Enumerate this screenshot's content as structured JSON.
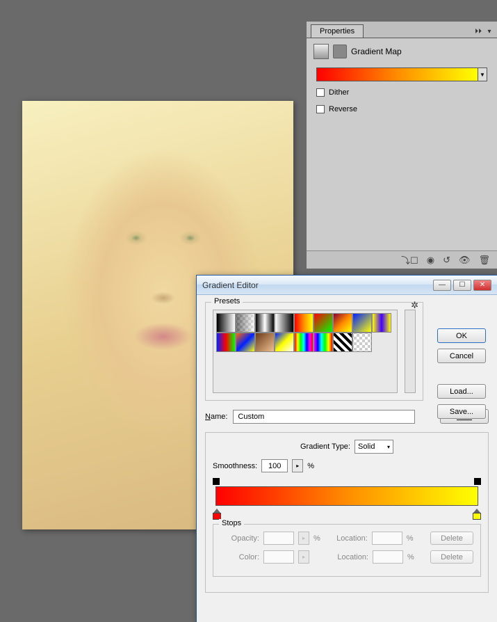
{
  "panel": {
    "tab": "Properties",
    "adjustment_name": "Gradient Map",
    "dither_label": "Dither",
    "reverse_label": "Reverse",
    "dropdown_glyph": "▼"
  },
  "dialog": {
    "title": "Gradient Editor",
    "ok": "OK",
    "cancel": "Cancel",
    "load": "Load...",
    "save": "Save...",
    "new": "New",
    "presets_label": "Presets",
    "name_label": "Name:",
    "name_value": "Custom",
    "type_label": "Gradient Type:",
    "type_value": "Solid",
    "smooth_label": "Smoothness:",
    "smooth_value": "100",
    "percent": "%",
    "stops_label": "Stops",
    "opacity_label": "Opacity:",
    "color_label": "Color:",
    "location_label": "Location:",
    "delete": "Delete",
    "gear": "✲",
    "arrow": "▸",
    "dropdown": "▾",
    "win_min": "—",
    "win_max": "☐",
    "win_close": "✕"
  },
  "chart_data": {
    "type": "gradient",
    "stops": [
      {
        "position": 0,
        "color": "#ff0000"
      },
      {
        "position": 100,
        "color": "#ffff00"
      }
    ],
    "opacity_stops": [
      {
        "position": 0,
        "opacity": 100
      },
      {
        "position": 100,
        "opacity": 100
      }
    ],
    "smoothness": 100,
    "gradient_type": "Solid"
  }
}
